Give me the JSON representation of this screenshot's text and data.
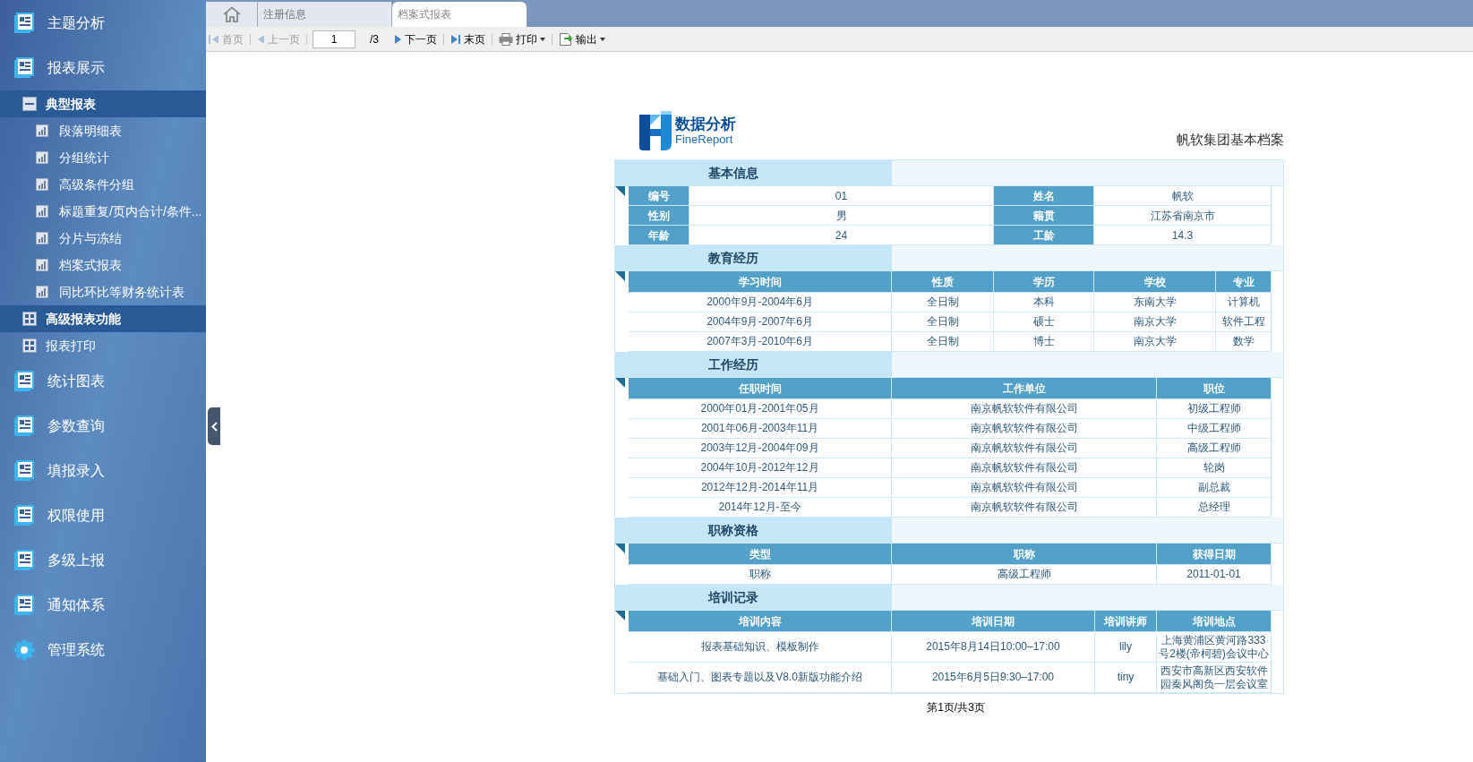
{
  "sidebar": {
    "items": [
      {
        "kind": "module",
        "label": "主题分析",
        "selected": false
      },
      {
        "kind": "module",
        "label": "报表展示",
        "selected": false
      },
      {
        "kind": "group",
        "label": "典型报表",
        "expanded": true,
        "selected": true
      },
      {
        "kind": "report",
        "label": "段落明细表",
        "selected": false
      },
      {
        "kind": "report",
        "label": "分组统计",
        "selected": false
      },
      {
        "kind": "report",
        "label": "高级条件分组",
        "selected": false
      },
      {
        "kind": "report",
        "label": "标题重复/页内合计/条件...",
        "selected": false
      },
      {
        "kind": "report",
        "label": "分片与冻结",
        "selected": false
      },
      {
        "kind": "report",
        "label": "档案式报表",
        "selected": false
      },
      {
        "kind": "report",
        "label": "同比环比等财务统计表",
        "selected": false
      },
      {
        "kind": "group",
        "label": "高级报表功能",
        "expanded": false,
        "selected": true
      },
      {
        "kind": "group",
        "label": "报表打印",
        "expanded": false,
        "selected": false
      },
      {
        "kind": "module",
        "label": "统计图表",
        "selected": false
      },
      {
        "kind": "module",
        "label": "参数查询",
        "selected": false
      },
      {
        "kind": "module",
        "label": "填报录入",
        "selected": false
      },
      {
        "kind": "module",
        "label": "权限使用",
        "selected": false
      },
      {
        "kind": "module",
        "label": "多级上报",
        "selected": false
      },
      {
        "kind": "module",
        "label": "通知体系",
        "selected": false
      },
      {
        "kind": "system",
        "label": "管理系统",
        "selected": false
      }
    ]
  },
  "tabs": [
    {
      "kind": "home",
      "selected": false
    },
    {
      "kind": "page",
      "label": "注册信息",
      "selected": false
    },
    {
      "kind": "page",
      "label": "档案式报表",
      "selected": true
    }
  ],
  "toolbar": {
    "items": [
      {
        "kind": "first",
        "label": "首页",
        "disabled": true
      },
      {
        "kind": "prev",
        "label": "上一页",
        "disabled": true
      },
      {
        "kind": "page",
        "value": "1",
        "total": "/3"
      },
      {
        "kind": "next",
        "label": "下一页",
        "disabled": false
      },
      {
        "kind": "last",
        "label": "末页",
        "disabled": false
      },
      {
        "kind": "print",
        "label": "打印",
        "disabled": false
      },
      {
        "kind": "export",
        "label": "输出",
        "disabled": false
      }
    ]
  },
  "report": {
    "logo": {
      "title": "数据分析",
      "subtitle": "FineReport"
    },
    "title": "帆软集团基本档案",
    "sections": [
      {
        "kind": "fields",
        "heading": "基本信息",
        "rows": [
          [
            "编号",
            "01",
            "姓名",
            "帆软"
          ],
          [
            "性别",
            "男",
            "籍贯",
            "江苏省南京市"
          ],
          [
            "年龄",
            "24",
            "工龄",
            "14.3"
          ]
        ]
      },
      {
        "kind": "table",
        "heading": "教育经历",
        "columns": [
          "学习时间",
          "性质",
          "学历",
          "学校",
          "专业"
        ],
        "rows": [
          [
            "2000年9月-2004年6月",
            "全日制",
            "本科",
            "东南大学",
            "计算机"
          ],
          [
            "2004年9月-2007年6月",
            "全日制",
            "硕士",
            "南京大学",
            "软件工程"
          ],
          [
            "2007年3月-2010年6月",
            "全日制",
            "博士",
            "南京大学",
            "数学"
          ]
        ]
      },
      {
        "kind": "table",
        "heading": "工作经历",
        "columns": [
          "任职时间",
          "工作单位",
          "职位"
        ],
        "rows": [
          [
            "2000年01月-2001年05月",
            "南京帆软软件有限公司",
            "初级工程师"
          ],
          [
            "2001年06月-2003年11月",
            "南京帆软软件有限公司",
            "中级工程师"
          ],
          [
            "2003年12月-2004年09月",
            "南京帆软软件有限公司",
            "高级工程师"
          ],
          [
            "2004年10月-2012年12月",
            "南京帆软软件有限公司",
            "轮岗"
          ],
          [
            "2012年12月-2014年11月",
            "南京帆软软件有限公司",
            "副总裁"
          ],
          [
            "2014年12月-至今",
            "南京帆软软件有限公司",
            "总经理"
          ]
        ]
      },
      {
        "kind": "table",
        "heading": "职称资格",
        "columns": [
          "类型",
          "职称",
          "获得日期"
        ],
        "rows": [
          [
            "职称",
            "高级工程师",
            "2011-01-01"
          ]
        ]
      },
      {
        "kind": "table",
        "heading": "培训记录",
        "columns": [
          "培训内容",
          "培训日期",
          "培训讲师",
          "培训地点"
        ],
        "rows": [
          [
            "报表基础知识、模板制作",
            "2015年8月14日10:00–17:00",
            "lily",
            "上海黄浦区黄河路333号2楼(帝柯碧)会议中心"
          ],
          [
            "基础入门、图表专题以及V8.0新版功能介绍",
            "2015年6月5日9:30–17:00",
            "tiny",
            "西安市高新区西安软件园秦风阁负一层会议室"
          ]
        ]
      }
    ],
    "footer": "第1页/共3页"
  }
}
